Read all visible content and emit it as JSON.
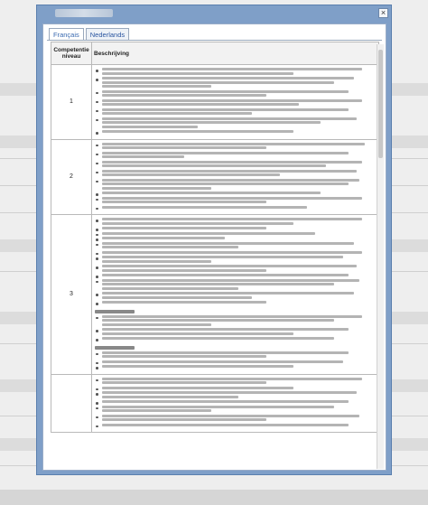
{
  "dialog": {
    "title": "",
    "close_glyph": "×"
  },
  "tabs": [
    {
      "label": "Français",
      "active": true
    },
    {
      "label": "Nederlands",
      "active": false
    }
  ],
  "table": {
    "headers": {
      "level": "Competentie niveau",
      "description": "Beschrijving"
    },
    "rows": [
      {
        "level": "1",
        "bullets": [
          [
            0.95,
            0.7
          ],
          [
            0.92,
            0.85,
            0.4
          ],
          [
            0.9,
            0.6
          ],
          [
            0.95,
            0.72
          ],
          [
            0.9,
            0.55
          ],
          [
            0.93,
            0.8,
            0.35
          ],
          [
            0.7
          ]
        ],
        "subsections": []
      },
      {
        "level": "2",
        "bullets": [
          [
            0.96,
            0.6
          ],
          [
            0.9,
            0.3
          ],
          [
            0.95,
            0.82
          ],
          [
            0.93,
            0.65
          ],
          [
            0.94,
            0.9,
            0.4
          ],
          [
            0.8
          ],
          [
            0.95,
            0.6
          ],
          [
            0.75
          ]
        ],
        "subsections": []
      },
      {
        "level": "3",
        "bullets": [
          [
            0.95,
            0.7
          ],
          [
            0.6
          ],
          [
            0.78
          ],
          [
            0.45
          ],
          [
            0.92,
            0.5
          ],
          [
            0.95
          ],
          [
            0.88,
            0.4
          ],
          [
            0.93,
            0.6
          ],
          [
            0.9
          ],
          [
            0.94,
            0.85,
            0.5
          ],
          [
            0.92,
            0.55
          ],
          [
            0.6
          ]
        ],
        "subsections": [
          {
            "bullets": [
              [
                0.95,
                0.85,
                0.4
              ],
              [
                0.9,
                0.7
              ],
              [
                0.85
              ]
            ]
          },
          {
            "bullets": [
              [
                0.9,
                0.6
              ],
              [
                0.88
              ],
              [
                0.7
              ]
            ]
          }
        ]
      },
      {
        "level": "",
        "bullets": [
          [
            0.95,
            0.6
          ],
          [
            0.7
          ],
          [
            0.93,
            0.5
          ],
          [
            0.9
          ],
          [
            0.85,
            0.4
          ],
          [
            0.94,
            0.6
          ],
          [
            0.9
          ]
        ],
        "subsections": []
      }
    ]
  }
}
